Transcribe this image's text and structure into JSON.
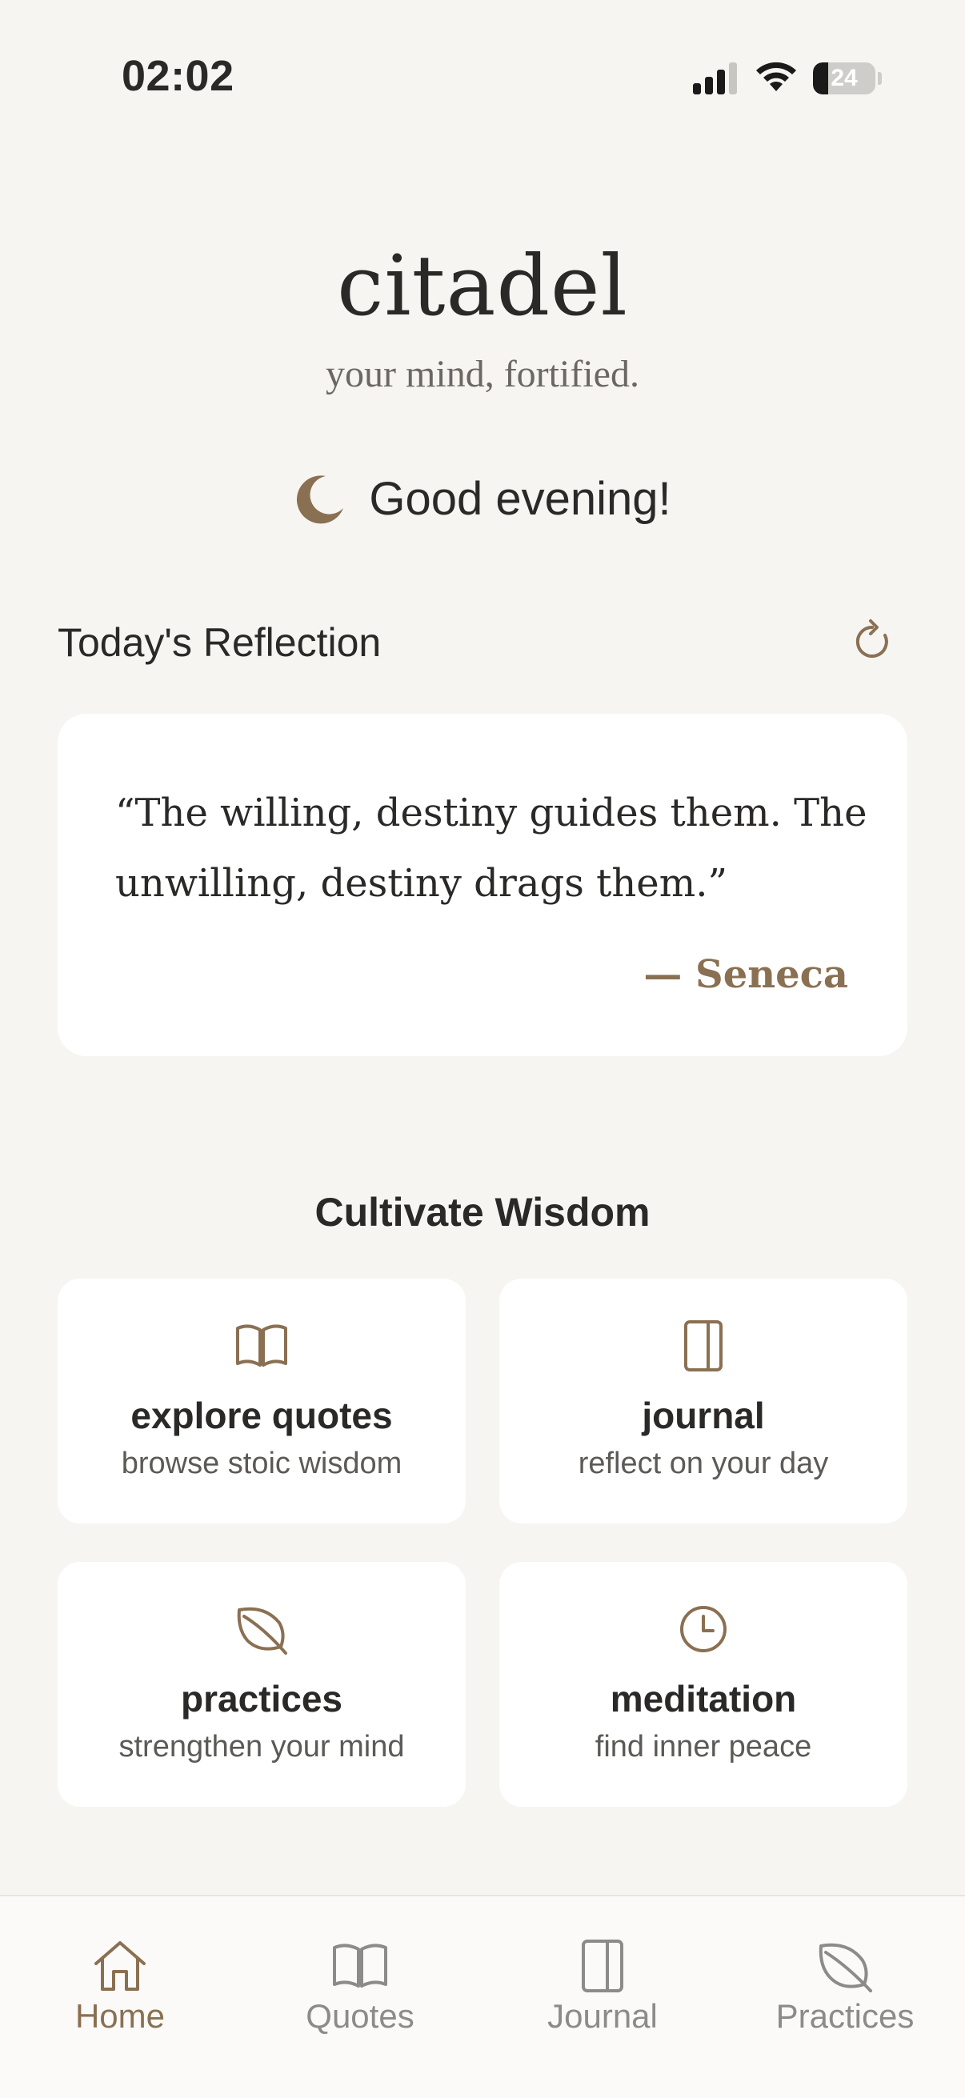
{
  "status_bar": {
    "time": "02:02",
    "battery": "24",
    "battery_level": 0.24,
    "icons": [
      "signal-icon",
      "wifi-icon",
      "battery-icon"
    ]
  },
  "header": {
    "title": "citadel",
    "tagline": "your mind, fortified."
  },
  "greeting": {
    "icon": "moon-icon",
    "text": "Good evening!"
  },
  "reflection": {
    "section_title": "Today's Reflection",
    "refresh_icon": "refresh-icon",
    "quote": "“The willing, destiny guides them. The unwilling, destiny drags them.”",
    "author": "— Seneca"
  },
  "wisdom": {
    "title": "Cultivate Wisdom",
    "tiles": [
      {
        "icon": "book-open-icon",
        "label": "explore quotes",
        "subtitle": "browse stoic wisdom"
      },
      {
        "icon": "journal-icon",
        "label": "journal",
        "subtitle": "reflect on your day"
      },
      {
        "icon": "leaf-icon",
        "label": "practices",
        "subtitle": "strengthen your mind"
      },
      {
        "icon": "clock-icon",
        "label": "meditation",
        "subtitle": "find inner peace"
      }
    ]
  },
  "nav": {
    "items": [
      {
        "icon": "home-icon",
        "label": "Home",
        "active": true
      },
      {
        "icon": "book-open-icon",
        "label": "Quotes",
        "active": false
      },
      {
        "icon": "journal-icon",
        "label": "Journal",
        "active": false
      },
      {
        "icon": "leaf-icon",
        "label": "Practices",
        "active": false
      }
    ]
  },
  "colors": {
    "background": "#f6f5f2",
    "accent": "#8a7052",
    "text": "#2a2927",
    "muted": "#8d8b87",
    "card": "#ffffff"
  }
}
